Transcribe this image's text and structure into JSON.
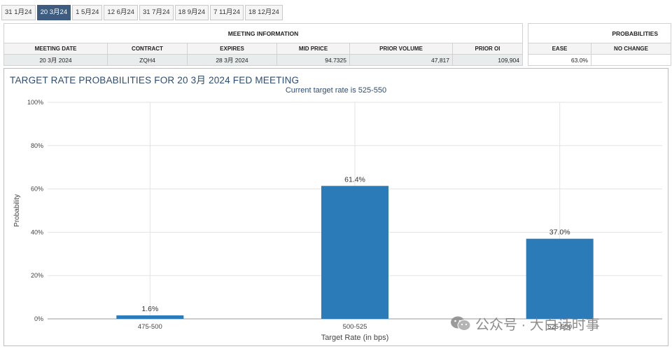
{
  "tabs": [
    {
      "label": "31 1月24",
      "active": false
    },
    {
      "label": "20 3月24",
      "active": true
    },
    {
      "label": "1 5月24",
      "active": false
    },
    {
      "label": "12 6月24",
      "active": false
    },
    {
      "label": "31 7月24",
      "active": false
    },
    {
      "label": "18 9月24",
      "active": false
    },
    {
      "label": "7 11月24",
      "active": false
    },
    {
      "label": "18 12月24",
      "active": false
    }
  ],
  "meeting_info": {
    "title": "MEETING INFORMATION",
    "headers": [
      "MEETING DATE",
      "CONTRACT",
      "EXPIRES",
      "MID PRICE",
      "PRIOR VOLUME",
      "PRIOR OI"
    ],
    "values": [
      "20 3月 2024",
      "ZQH4",
      "28 3月 2024",
      "94.7325",
      "47,817",
      "109,904"
    ]
  },
  "probabilities": {
    "title": "PROBABILITIES",
    "headers": [
      "EASE",
      "NO CHANGE"
    ],
    "values": [
      "63.0%",
      ""
    ]
  },
  "chart": {
    "title": "TARGET RATE PROBABILITIES FOR 20 3月 2024 FED MEETING",
    "subtitle": "Current target rate is 525-550"
  },
  "chart_data": {
    "type": "bar",
    "categories": [
      "475-500",
      "500-525",
      "525-550"
    ],
    "values": [
      1.6,
      61.4,
      37.0
    ],
    "data_labels": [
      "1.6%",
      "61.4%",
      "37.0%"
    ],
    "xlabel": "Target Rate (in bps)",
    "ylabel": "Probability",
    "ylim": [
      0,
      100
    ],
    "yticks": [
      "0%",
      "20%",
      "40%",
      "60%",
      "80%",
      "100%"
    ],
    "grid": true,
    "bar_color": "#2b7bb9"
  },
  "watermark": {
    "text": "公众号 · 大白话时事"
  }
}
